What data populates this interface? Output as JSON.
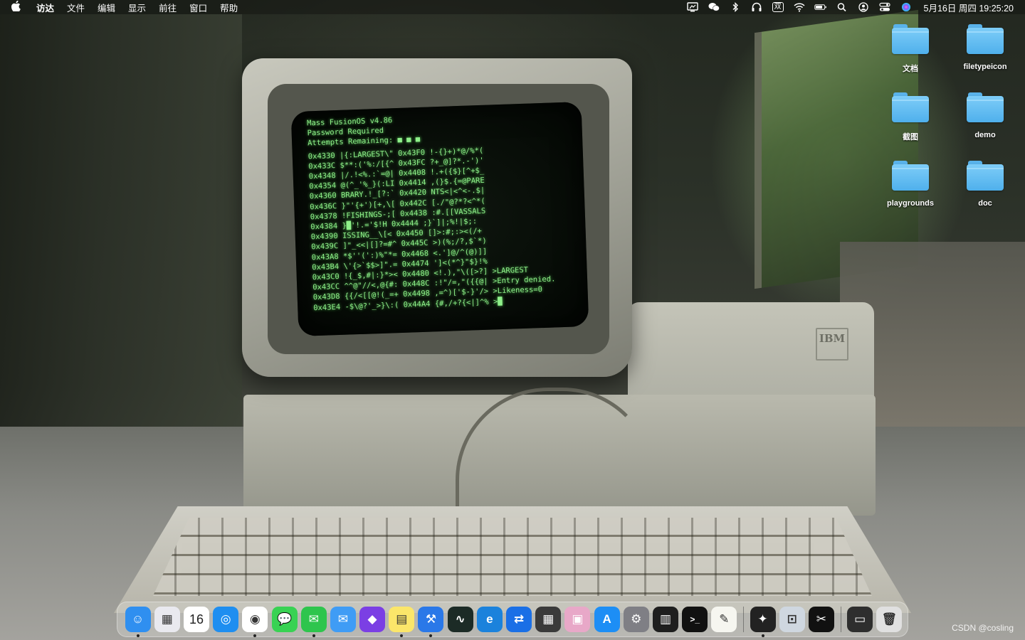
{
  "menubar": {
    "apple_icon": "apple-icon",
    "app_name": "访达",
    "items": [
      "文件",
      "编辑",
      "显示",
      "前往",
      "窗口",
      "帮助"
    ],
    "status_icons": [
      "display-icon",
      "wechat-icon",
      "bluetooth-icon",
      "headphones-icon",
      "ime-icon",
      "wifi-icon",
      "battery-icon",
      "search-icon",
      "user-icon",
      "control-center-icon",
      "siri-icon"
    ],
    "ime_label": "双",
    "datetime": "5月16日 周四 19:25:20"
  },
  "desktop": {
    "icons": [
      {
        "label": "文档",
        "icon": "folder-icon"
      },
      {
        "label": "filetypeicon",
        "icon": "folder-icon"
      },
      {
        "label": "截图",
        "icon": "folder-icon"
      },
      {
        "label": "demo",
        "icon": "folder-icon"
      },
      {
        "label": "playgrounds",
        "icon": "folder-icon"
      },
      {
        "label": "doc",
        "icon": "folder-icon"
      }
    ]
  },
  "wallpaper": {
    "terminal_lines": [
      "Mass FusionOS v4.86",
      "Password Required",
      "Attempts Remaining: ■ ■ ■",
      "0x4330 |{:LARGEST\\\" 0x43F0 !-{}+)*@/%*(",
      "0x433C $**:('%:/[{^ 0x43FC ?+_@]?*.-')'",
      "0x4348 |/.!<%.:`=@| 0x4408 !.+({$}[^+$_",
      "0x4354 @(^_'%_}(:LI 0x4414 ,(}$.{=@PARE",
      "0x4360 BRARY.!_[?:` 0x4420 NTS<|<^<-.$|",
      "0x436C }\"'{+')[+,\\[ 0x442C [./\"@?*?<^*(",
      "0x4378 !FISHINGS-;[ 0x4438 :#.[[VASSALS",
      "0x4384 }█'!.='$!H 0x4444 ;}`]|;%!|$;:",
      "0x4390 ISSING__\\[< 0x4450 []>:#;:><(/+",
      "0x439C ]\"_<<|[]?=#^ 0x445C >)(%;/?,$`*)",
      "0x43A8 *$''(':)%\"*= 0x4468 <.']@/^(@)]]",
      "0x43B4 \\'{>`$$>]\".= 0x4474 ']<(*^}\"$}!%",
      "0x43C0 !{_$,#|:}*>< 0x4480 <!.),\"\\([>?] >LARGEST",
      "0x43CC ^^@\"//<,@{#: 0x448C :!\"/=,\"({{@| >Entry denied.",
      "0x43D8 {{/<[[@!(_=+ 0x4498 ,=^)['$-}'/> >Likeness=0",
      "0x43E4 -$\\@?'_>}\\:( 0x44A4 {#,/+?{<|]^% >█"
    ],
    "brand": "IBM"
  },
  "dock": {
    "apps": [
      {
        "name": "finder",
        "icon": "finder-icon",
        "bg": "#2f8ff0",
        "glyph": "☺",
        "running": true
      },
      {
        "name": "launchpad",
        "icon": "launchpad-icon",
        "bg": "#e9e9ef",
        "glyph": "▦",
        "running": false
      },
      {
        "name": "calendar",
        "icon": "calendar-icon",
        "bg": "#ffffff",
        "glyph": "16",
        "running": false
      },
      {
        "name": "safari",
        "icon": "safari-icon",
        "bg": "#1e8ef0",
        "glyph": "◎",
        "running": false
      },
      {
        "name": "chrome",
        "icon": "chrome-icon",
        "bg": "#ffffff",
        "glyph": "◉",
        "running": true
      },
      {
        "name": "messages",
        "icon": "messages-icon",
        "bg": "#38d253",
        "glyph": "💬",
        "running": false
      },
      {
        "name": "wechat",
        "icon": "wechat-icon",
        "bg": "#2ec54d",
        "glyph": "✉",
        "running": true
      },
      {
        "name": "mail",
        "icon": "mail-icon",
        "bg": "#3f9cf5",
        "glyph": "✉",
        "running": false
      },
      {
        "name": "github-desktop",
        "icon": "github-icon",
        "bg": "#7b3fe4",
        "glyph": "◆",
        "running": false
      },
      {
        "name": "notes",
        "icon": "notes-icon",
        "bg": "#fbe66a",
        "glyph": "▤",
        "running": true
      },
      {
        "name": "xcode",
        "icon": "xcode-icon",
        "bg": "#2a78e8",
        "glyph": "⚒",
        "running": true
      },
      {
        "name": "activity-monitor",
        "icon": "activity-monitor-icon",
        "bg": "#1c2b26",
        "glyph": "∿",
        "running": false
      },
      {
        "name": "edge",
        "icon": "edge-icon",
        "bg": "#1b82dc",
        "glyph": "e",
        "running": false
      },
      {
        "name": "teamviewer",
        "icon": "teamviewer-icon",
        "bg": "#1a6fe6",
        "glyph": "⇄",
        "running": false
      },
      {
        "name": "calculator",
        "icon": "calculator-icon",
        "bg": "#3a3a3a",
        "glyph": "▦",
        "running": false
      },
      {
        "name": "preview",
        "icon": "preview-icon",
        "bg": "#e8a8c8",
        "glyph": "▣",
        "running": false
      },
      {
        "name": "app-store",
        "icon": "app-store-icon",
        "bg": "#1d8ef5",
        "glyph": "A",
        "running": false
      },
      {
        "name": "system-settings",
        "icon": "settings-icon",
        "bg": "#7f7f85",
        "glyph": "⚙",
        "running": false
      },
      {
        "name": "piano",
        "icon": "piano-icon",
        "bg": "#1e1e1e",
        "glyph": "▥",
        "running": false
      },
      {
        "name": "terminal",
        "icon": "terminal-icon",
        "bg": "#111111",
        "glyph": ">_",
        "running": false
      },
      {
        "name": "textedit",
        "icon": "textedit-icon",
        "bg": "#f6f6f0",
        "glyph": "✎",
        "running": false
      },
      {
        "name": "final-cut-pro",
        "icon": "final-cut-icon",
        "bg": "#222222",
        "glyph": "✦",
        "running": true
      },
      {
        "name": "preview-2",
        "icon": "image-viewer-icon",
        "bg": "#cfd7e0",
        "glyph": "⊡",
        "running": false
      },
      {
        "name": "capcut",
        "icon": "capcut-icon",
        "bg": "#111111",
        "glyph": "✂",
        "running": false
      }
    ],
    "extras": [
      {
        "name": "screen-recorder",
        "icon": "screen-recorder-icon",
        "bg": "#2e2e2e",
        "glyph": "▭"
      },
      {
        "name": "trash",
        "icon": "trash-icon",
        "bg": "#e0e0e0",
        "glyph": "🗑"
      }
    ]
  },
  "watermark": "CSDN @cosling"
}
